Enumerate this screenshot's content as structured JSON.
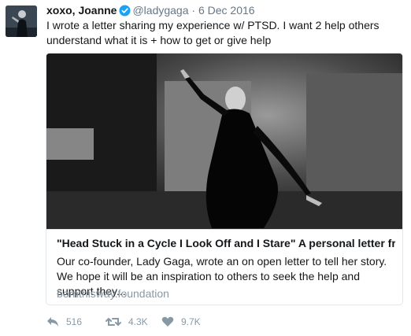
{
  "tweet": {
    "author_name": "xoxo, Joanne",
    "handle": "@ladygaga",
    "separator": "·",
    "date": "6 Dec 2016",
    "text": "I wrote a letter sharing my experience w/ PTSD. I want 2 help others understand what it is + how to get or give help"
  },
  "card": {
    "title": "\"Head Stuck in a Cycle I Look Off and I Stare\" A personal letter from..",
    "description": "Our co-founder, Lady Gaga, wrote an on open letter to tell her story. We hope it will be an inspiration to others to seek the help and support they...",
    "domain": "bornthisway.foundation"
  },
  "actions": {
    "reply_count": "516",
    "retweet_count": "4.3K",
    "like_count": "9.7K"
  },
  "colors": {
    "verified": "#1da1f2",
    "muted_text": "#8899a6",
    "border": "#e1e8ed"
  },
  "icons": [
    "verified-badge-icon",
    "reply-icon",
    "retweet-icon",
    "like-icon"
  ]
}
